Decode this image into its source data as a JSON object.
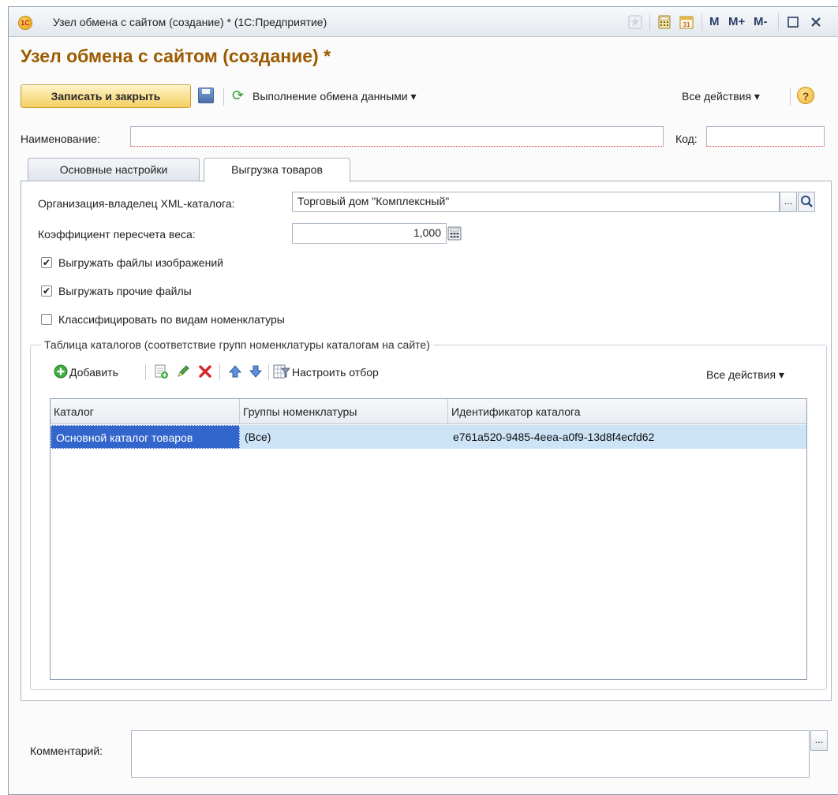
{
  "window": {
    "title": "Узел обмена с сайтом (создание) * (1С:Предприятие)",
    "logo": "1С"
  },
  "title_bar_buttons": {
    "m": "M",
    "m_plus": "M+",
    "m_minus": "M-"
  },
  "page_title": "Узел обмена с сайтом (создание) *",
  "toolbar": {
    "save_close": "Записать и закрыть",
    "exchange": "Выполнение обмена данными ▾",
    "all_actions": "Все действия ▾"
  },
  "fields": {
    "name_label": "Наименование:",
    "name_value": "",
    "code_label": "Код:",
    "code_value": ""
  },
  "tabs": [
    "Основные настройки",
    "Выгрузка товаров"
  ],
  "export": {
    "org_label": "Организация-владелец XML-каталога:",
    "org_value": "Торговый дом \"Комплексный\"",
    "weight_label": "Коэффициент пересчета веса:",
    "weight_value": "1,000",
    "options": [
      {
        "label": "Выгружать файлы изображений",
        "checked": true
      },
      {
        "label": "Выгружать прочие файлы",
        "checked": true
      },
      {
        "label": "Классифицировать по видам номенклатуры",
        "checked": false
      }
    ]
  },
  "catalog_table": {
    "legend": "Таблица каталогов (соответствие групп номенклатуры каталогам на сайте)",
    "add_label": "Добавить",
    "filter_label": "Настроить отбор",
    "all_actions": "Все действия ▾",
    "columns": [
      "Каталог",
      "Группы номенклатуры",
      "Идентификатор каталога"
    ],
    "rows": [
      {
        "catalog": "Основной каталог товаров",
        "groups": "(Все)",
        "id": "e761a520-9485-4eea-a0f9-13d8f4ecfd62"
      }
    ]
  },
  "comment": {
    "label": "Комментарий:",
    "value": ""
  },
  "colors": {
    "accent_title": "#9c5b00",
    "primary_button": "#f4cf62",
    "selection": "#3366cc",
    "row_highlight": "#cde4f7"
  }
}
